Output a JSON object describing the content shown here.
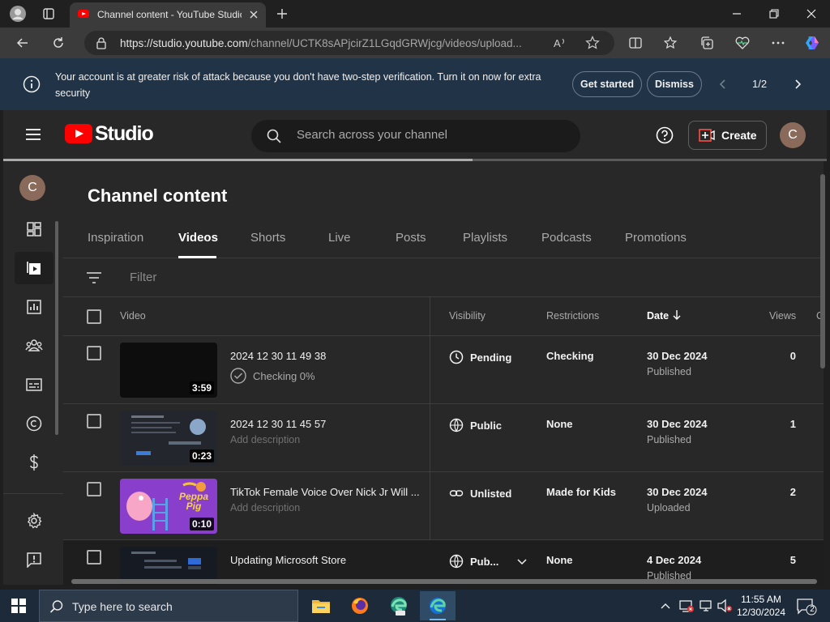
{
  "browser": {
    "tab_title": "Channel content - YouTube Studio",
    "url_host": "https://studio.youtube.com",
    "url_path": "/channel/UCTK8sAPjcirZ1LGqdGRWjcg/videos/upload..."
  },
  "notification": {
    "message": "Your account is at greater risk of attack because you don't have two-step verification. Turn it on now for extra security",
    "primary_button": "Get started",
    "secondary_button": "Dismiss",
    "pager": "1/2"
  },
  "studio": {
    "logo_text": "Studio",
    "search_placeholder": "Search across your channel",
    "create_label": "Create",
    "avatar_initial": "C",
    "page_title": "Channel content",
    "tabs": [
      {
        "label": "Inspiration",
        "active": false
      },
      {
        "label": "Videos",
        "active": true
      },
      {
        "label": "Shorts",
        "active": false
      },
      {
        "label": "Live",
        "active": false
      },
      {
        "label": "Posts",
        "active": false
      },
      {
        "label": "Playlists",
        "active": false
      },
      {
        "label": "Podcasts",
        "active": false
      },
      {
        "label": "Promotions",
        "active": false
      }
    ],
    "filter_placeholder": "Filter",
    "columns": {
      "video": "Video",
      "visibility": "Visibility",
      "restrictions": "Restrictions",
      "date": "Date",
      "views": "Views"
    },
    "videos": [
      {
        "title": "2024 12 30 11 49 38",
        "subtitle": "Checking 0%",
        "duration": "3:59",
        "visibility": "Pending",
        "visibility_icon": "clock-icon",
        "restrictions": "Checking",
        "date": "30 Dec 2024",
        "date_status": "Published",
        "views": "0"
      },
      {
        "title": "2024 12 30 11 45 57",
        "subtitle": "Add description",
        "duration": "0:23",
        "visibility": "Public",
        "visibility_icon": "globe-icon",
        "restrictions": "None",
        "date": "30 Dec 2024",
        "date_status": "Published",
        "views": "1"
      },
      {
        "title": "TikTok Female Voice Over Nick Jr Will ...",
        "subtitle": "Add description",
        "duration": "0:10",
        "visibility": "Unlisted",
        "visibility_icon": "link-icon",
        "restrictions": "Made for Kids",
        "date": "30 Dec 2024",
        "date_status": "Uploaded",
        "views": "2",
        "thumb_text": "Peppa Pig"
      },
      {
        "title": "Updating Microsoft Store",
        "subtitle": "",
        "duration": "",
        "visibility": "Pub...",
        "visibility_icon": "globe-icon",
        "restrictions": "None",
        "date": "4 Dec 2024",
        "date_status": "Published",
        "views": "5"
      }
    ]
  },
  "taskbar": {
    "search_placeholder": "Type here to search",
    "time": "11:55 AM",
    "date": "12/30/2024",
    "notification_count": "2"
  },
  "colors": {
    "youtube_red": "#ff0000",
    "notice_bg": "#213346",
    "studio_bg": "#282828"
  }
}
